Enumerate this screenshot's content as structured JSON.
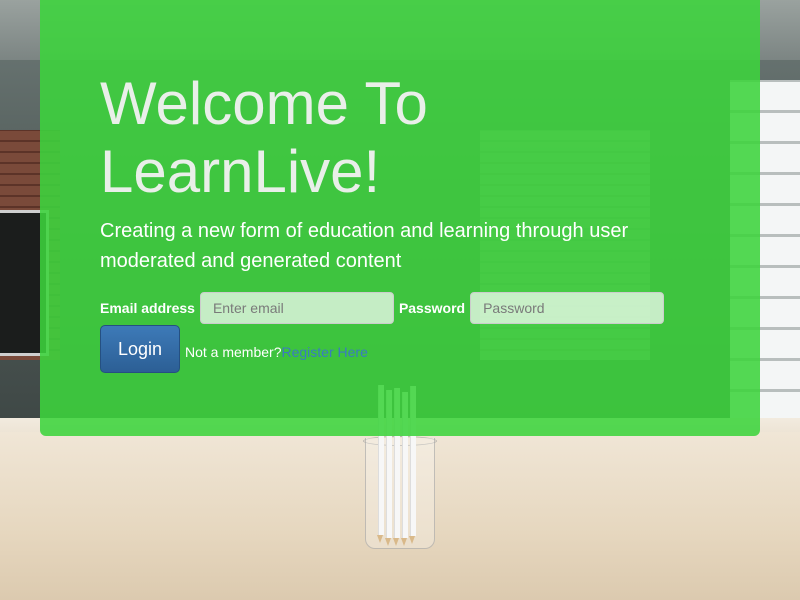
{
  "hero": {
    "title_line1": "Welcome To",
    "title_line2": "LearnLive!",
    "subtitle": "Creating a new form of education and learning through user moderated and generated content"
  },
  "login_form": {
    "email_label": "Email address",
    "email_placeholder": "Enter email",
    "email_value": "",
    "password_label": "Password",
    "password_placeholder": "Password",
    "password_value": "",
    "login_button": "Login",
    "member_prompt": "Not a member?",
    "register_link": "Register Here"
  },
  "colors": {
    "overlay": "#3cd43c",
    "button": "#337ab7",
    "link": "#3a7bc0"
  }
}
